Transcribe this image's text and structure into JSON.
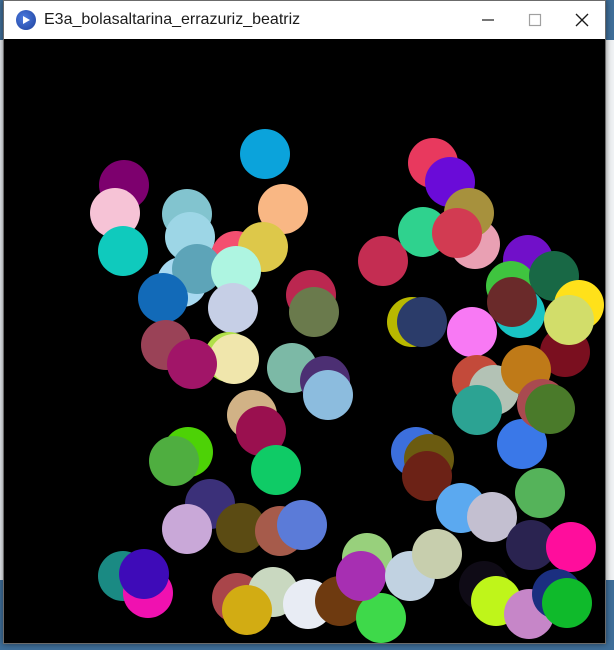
{
  "window": {
    "title": "E3a_bolasaltarina_errazuriz_beatriz",
    "app_icon": "processing-play-icon",
    "controls": [
      "minimize-icon",
      "maximize-icon",
      "close-icon"
    ]
  },
  "canvas": {
    "background": "#000000",
    "ball_colors": [
      "#0ba3db",
      "#7d006e",
      "#f6c3d6",
      "#82c4cf",
      "#f9b784",
      "#e8395e",
      "#0fcabd",
      "#9dd6e6",
      "#f44f70",
      "#a8d9f0",
      "#ddc84a",
      "#5da4b8",
      "#aef5e1",
      "#126ab8",
      "#c6cfe6",
      "#bb2750",
      "#6a7a4c",
      "#9a4257",
      "#b1e04a",
      "#f0e6ac",
      "#a11568",
      "#7cb9a6",
      "#4c2f73",
      "#8cbcde",
      "#d1b286",
      "#9a104f",
      "#c42d52",
      "#2fd28e",
      "#6a0bd8",
      "#e9a0b3",
      "#a7913d",
      "#d23b52",
      "#7110c9",
      "#3fc43f",
      "#19c4c4",
      "#186845",
      "#ffe11a",
      "#7a0f1f",
      "#d2dd6a",
      "#6a2a2a",
      "#b8b800",
      "#f879f4",
      "#2b3c6a",
      "#c34a3a",
      "#b3c2b5",
      "#bf7a18",
      "#2ca393",
      "#3a78e8",
      "#a94a50",
      "#4a7a2a",
      "#0fcb66",
      "#4dd206",
      "#4fae40",
      "#3c6fdc",
      "#6b5b10",
      "#6c2216",
      "#5ba9f0",
      "#c3bfd0",
      "#55b35a",
      "#3b3079",
      "#c9a8d8",
      "#5b4b13",
      "#a65b4b",
      "#5b7bd8",
      "#1a8a83",
      "#f011b0",
      "#3e0bb8",
      "#a9454a",
      "#c9d8c0",
      "#d2ac13",
      "#e8ecf4",
      "#6e3a10",
      "#3ed94a",
      "#98d07c",
      "#a72fb2",
      "#c1d2e1",
      "#c7cead",
      "#0f0b16",
      "#bff51a",
      "#c686c8",
      "#2a2350",
      "#ff0d9c",
      "#1b2f80",
      "#0fba2b"
    ]
  }
}
